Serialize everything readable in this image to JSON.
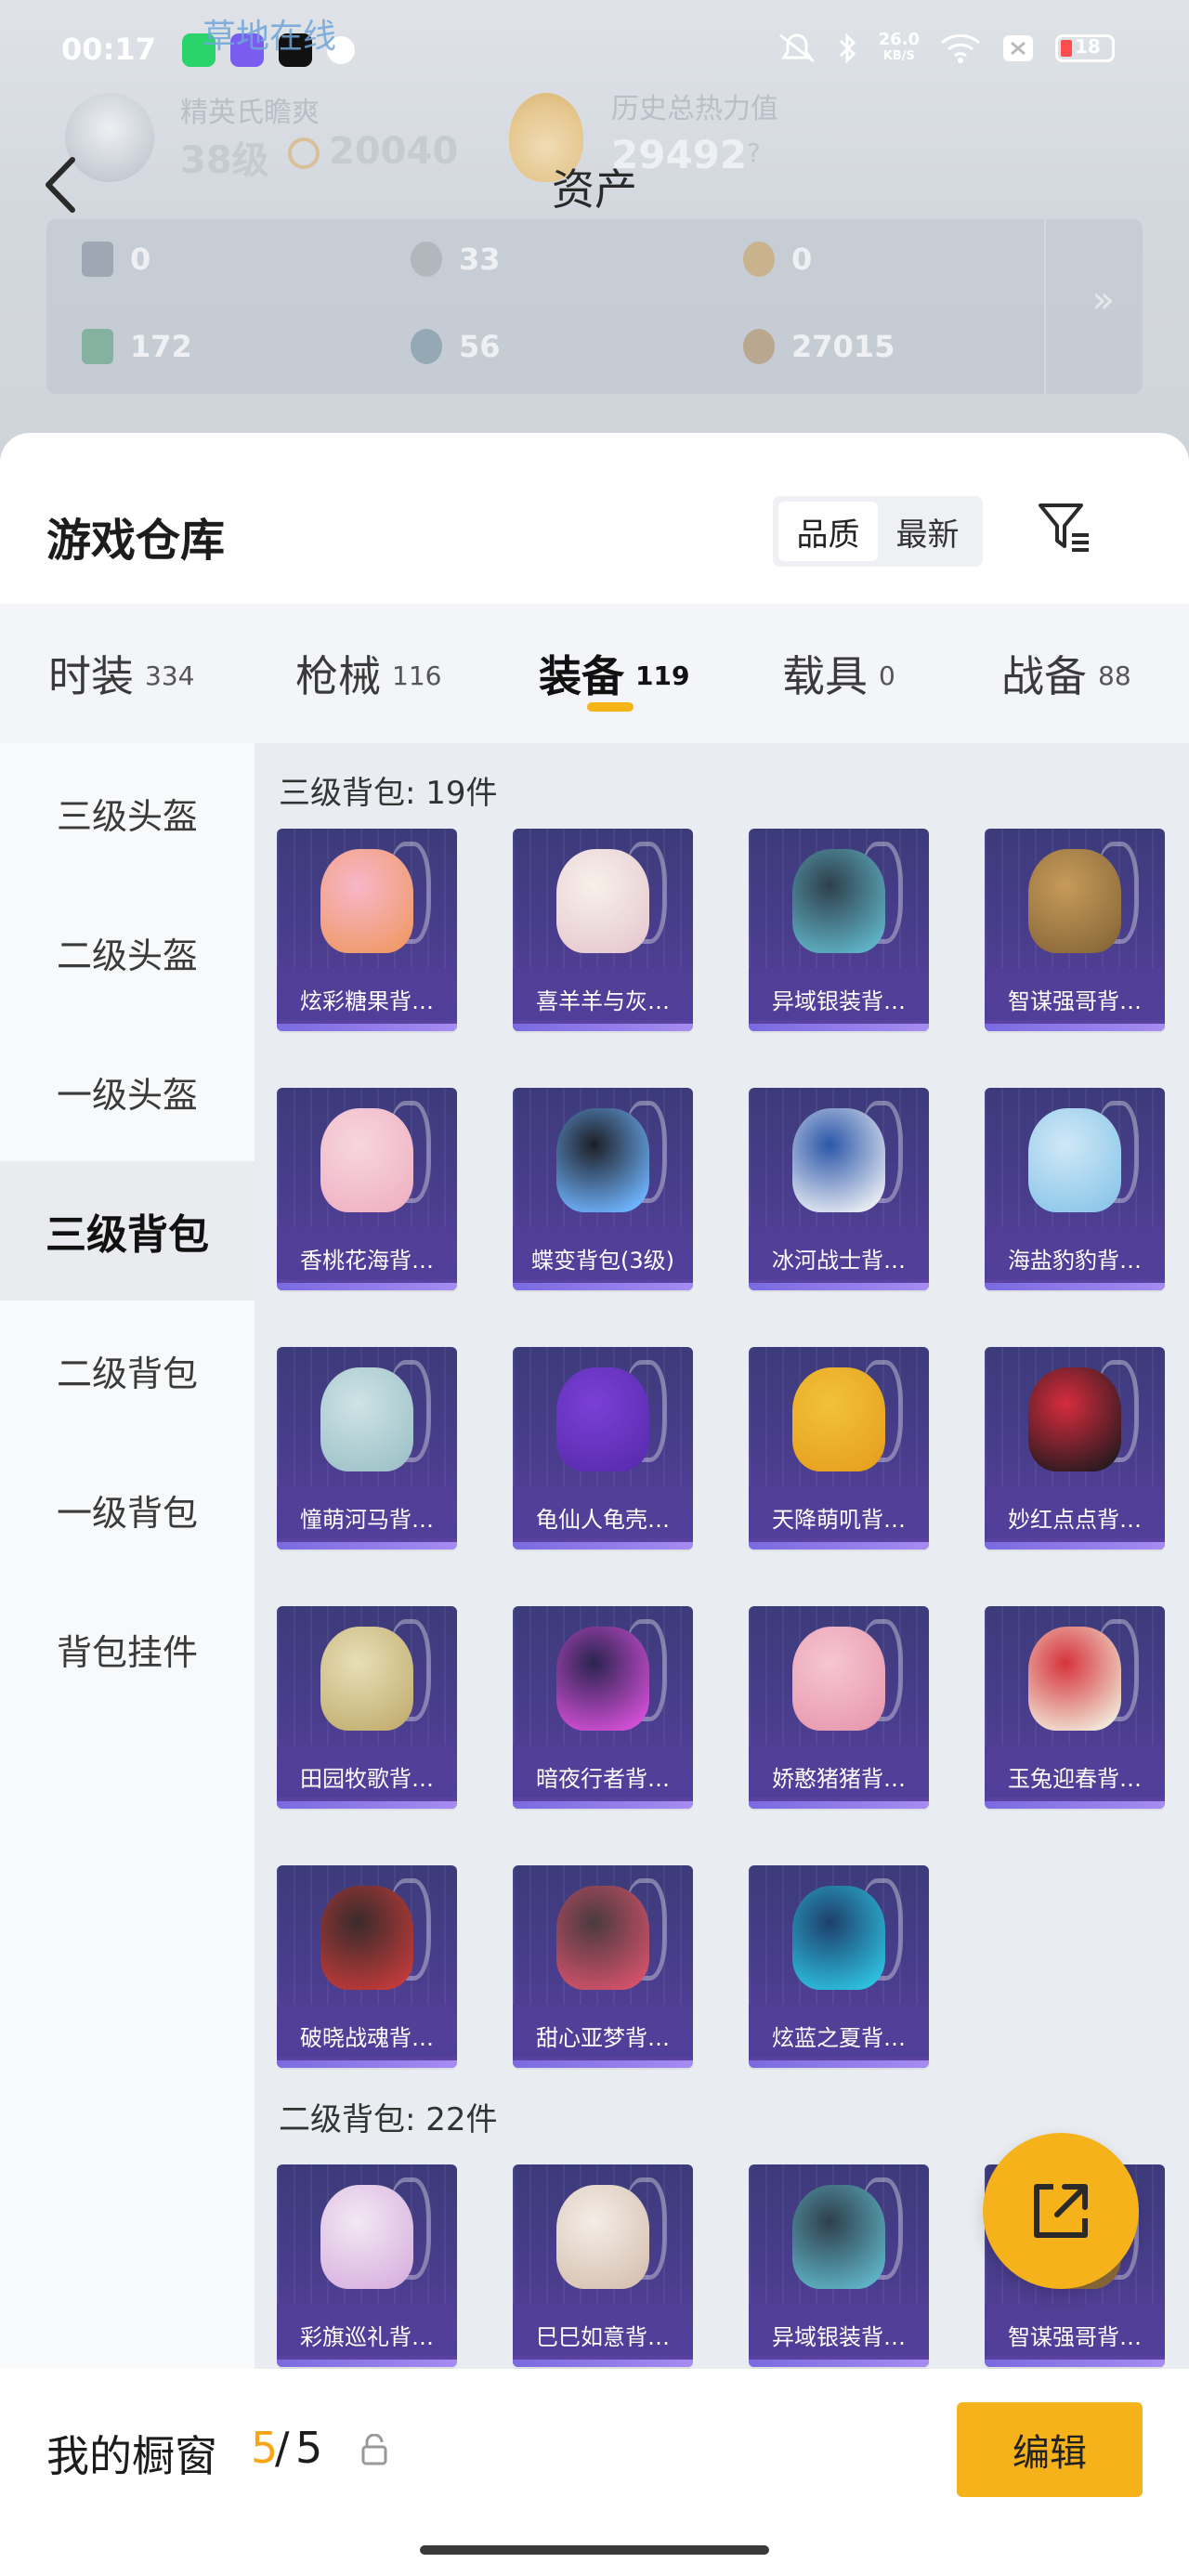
{
  "status_bar": {
    "time": "00:17",
    "network_speed_value": "26.0",
    "network_speed_unit": "KB/S",
    "battery_level": "18"
  },
  "header": {
    "ghost_online": "草地在线",
    "rank_label": "精英氏瞻爽",
    "rank_level": "38级",
    "rank_score": "20040",
    "heat_label": "历史总热力值",
    "heat_value": "29492",
    "heat_help": "?",
    "title": "资产",
    "assets": [
      {
        "icon": "card-icon",
        "value": "0"
      },
      {
        "icon": "silver-coin-icon",
        "value": "33"
      },
      {
        "icon": "gold-coin-icon",
        "value": "0"
      },
      {
        "icon": "ticket-icon",
        "value": "172"
      },
      {
        "icon": "gem-icon",
        "value": "56"
      },
      {
        "icon": "bronze-coin-icon",
        "value": "27015"
      }
    ],
    "more": "»"
  },
  "sheet": {
    "title": "游戏仓库",
    "sort_options": [
      "品质",
      "最新"
    ],
    "tabs": [
      {
        "label": "时装",
        "count": "334"
      },
      {
        "label": "枪械",
        "count": "116"
      },
      {
        "label": "装备",
        "count": "119"
      },
      {
        "label": "载具",
        "count": "0"
      },
      {
        "label": "战备",
        "count": "88"
      }
    ],
    "side_nav": [
      "三级头盔",
      "二级头盔",
      "一级头盔",
      "三级背包",
      "二级背包",
      "一级背包",
      "背包挂件"
    ],
    "section_1_title": "三级背包: 19件",
    "section_2_title": "二级背包: 22件",
    "items_level3": [
      "炫彩糖果背…",
      "喜羊羊与灰…",
      "异域银装背…",
      "智谋强哥背…",
      "香桃花海背…",
      "蝶变背包(3级)",
      "冰河战士背…",
      "海盐豹豹背…",
      "憧萌河马背…",
      "龟仙人龟壳…",
      "天降萌叽背…",
      "妙红点点背…",
      "田园牧歌背…",
      "暗夜行者背…",
      "娇憨猪猪背…",
      "玉兔迎春背…",
      "破晓战魂背…",
      "甜心亚梦背…",
      "炫蓝之夏背…"
    ],
    "items_level2": [
      "彩旗巡礼背…",
      "巳巳如意背…",
      "异域银装背…",
      "智谋强哥背…"
    ]
  },
  "bottom": {
    "showcase_label": "我的橱窗",
    "showcase_count": "5",
    "showcase_sep": "/",
    "showcase_total": "5",
    "edit_label": "编辑"
  },
  "colors": {
    "accent": "#f6b21b",
    "card_bg": "#4a3d8d"
  }
}
